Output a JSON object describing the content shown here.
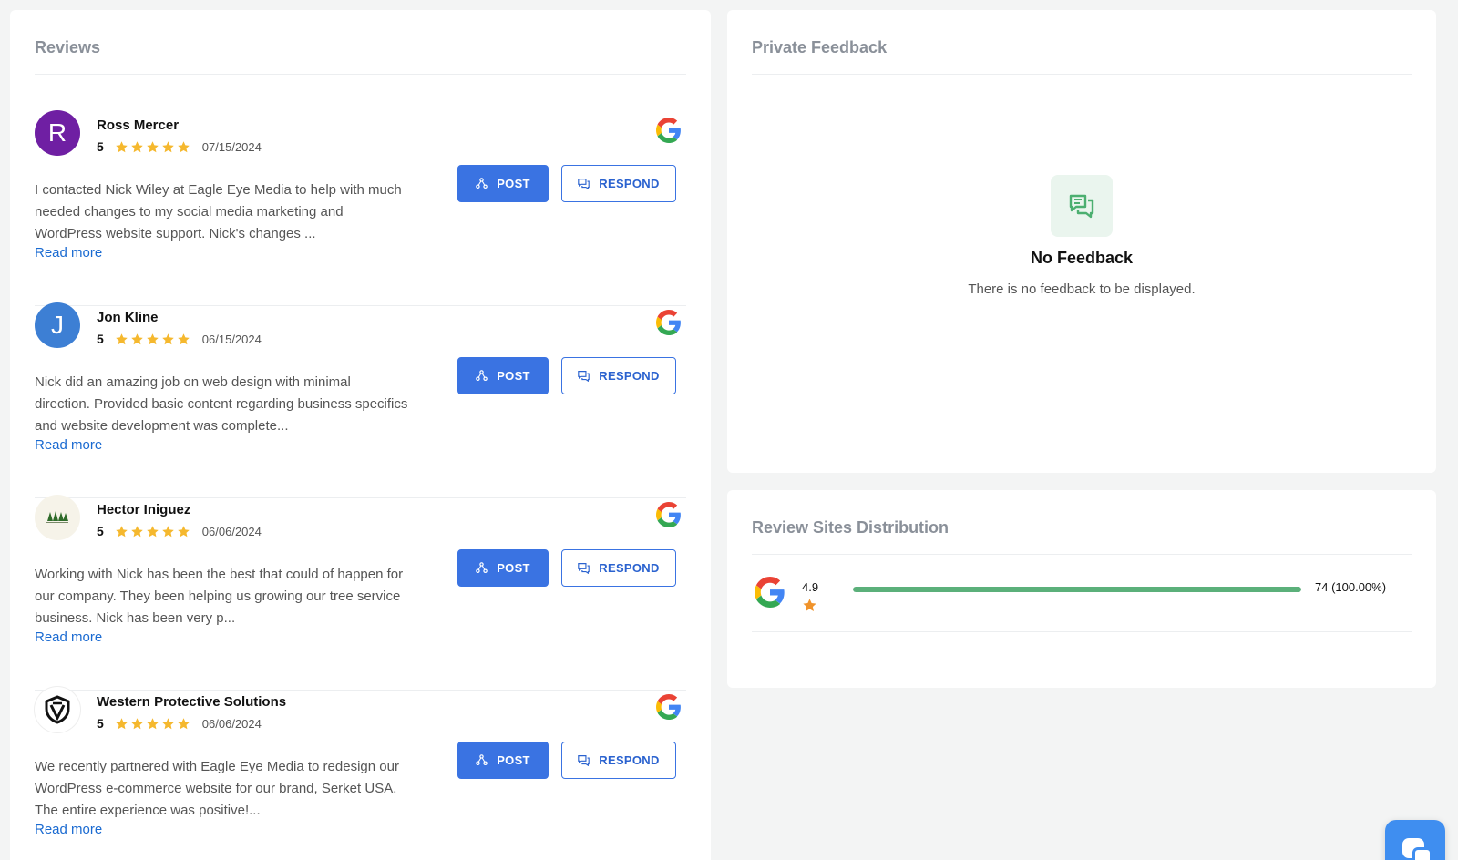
{
  "reviews_panel": {
    "title": "Reviews",
    "post_label": "POST",
    "respond_label": "RESPOND",
    "read_more_label": "Read more",
    "items": [
      {
        "name": "Ross Mercer",
        "avatar_letter": "R",
        "rating": "5",
        "stars": 5,
        "date": "07/15/2024",
        "source_icon": "google-icon",
        "text": "I contacted Nick Wiley at Eagle Eye Media to help with much needed changes to my social media marketing and WordPress website support. Nick's changes ..."
      },
      {
        "name": "Jon Kline",
        "avatar_letter": "J",
        "rating": "5",
        "stars": 5,
        "date": "06/15/2024",
        "source_icon": "google-icon",
        "text": "Nick did an amazing job on web design with minimal direction. Provided basic content regarding business specifics and website development was complete..."
      },
      {
        "name": "Hector Iniguez",
        "avatar_letter": "",
        "rating": "5",
        "stars": 5,
        "date": "06/06/2024",
        "source_icon": "google-icon",
        "text": "Working with Nick has been the best that could of happen for our company. They been helping us growing our tree service business. Nick has been very p..."
      },
      {
        "name": "Western Protective Solutions",
        "avatar_letter": "",
        "rating": "5",
        "stars": 5,
        "date": "06/06/2024",
        "source_icon": "google-icon",
        "text": "We recently partnered with Eagle Eye Media to redesign our WordPress e-commerce website for our brand, Serket USA. The entire experience was positive!..."
      }
    ]
  },
  "feedback_panel": {
    "title": "Private Feedback",
    "empty_icon": "chat-bubbles-icon",
    "empty_title": "No Feedback",
    "empty_description": "There is no feedback to be displayed."
  },
  "distribution_panel": {
    "title": "Review Sites Distribution",
    "sites": [
      {
        "icon": "google-icon",
        "rating": "4.9",
        "share": 1.0,
        "count_label": "74 (100.00%)"
      }
    ]
  },
  "colors": {
    "primary": "#3a73e2",
    "star": "#f5b82e",
    "bar": "#5bb07a",
    "link": "#1a6ad1"
  }
}
